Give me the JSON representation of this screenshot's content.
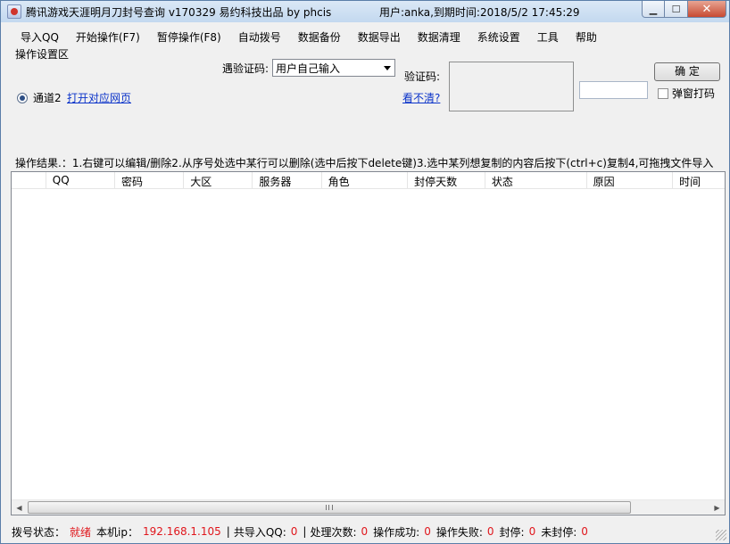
{
  "window": {
    "title": "腾讯游戏天涯明月刀封号查询  v170329  易约科技出品  by phcis",
    "user_info": "用户:anka,到期时间:2018/5/2 17:45:29",
    "minimize_glyph": "▁",
    "maximize_glyph": "☐",
    "close_glyph": "✕"
  },
  "menu": [
    {
      "label": "导入QQ"
    },
    {
      "label": "开始操作(F7)"
    },
    {
      "label": "暂停操作(F8)"
    },
    {
      "label": "自动拨号"
    },
    {
      "label": "数据备份"
    },
    {
      "label": "数据导出"
    },
    {
      "label": "数据清理"
    },
    {
      "label": "系统设置"
    },
    {
      "label": "工具"
    },
    {
      "label": "帮助"
    }
  ],
  "settings": {
    "group_title": "操作设置区",
    "channel_label": "通道2",
    "open_page_link": "打开对应网页",
    "vc_mode_label": "遇验证码:",
    "vc_mode_value": "用户自己输入",
    "vc_label": "验证码:",
    "unclear_link": "看不清?",
    "confirm_button": "确 定",
    "popup_checkbox": "弹窗打码",
    "captcha_value": ""
  },
  "result_line": "操作结果.：1.右键可以编辑/删除2.从序号处选中某行可以删除(选中后按下delete键)3.选中某列想复制的内容后按下(ctrl+c)复制4,可拖拽文件导入",
  "table": {
    "columns": [
      "",
      "QQ",
      "密码",
      "大区",
      "服务器",
      "角色",
      "封停天数",
      "状态",
      "原因",
      "时间"
    ],
    "rows": []
  },
  "status": {
    "dial_label": "拨号状态：",
    "dial_value": "就绪",
    "ip_label": "本机ip：",
    "ip_value": "192.168.1.105",
    "sep": "|",
    "imported_label": "共导入QQ:",
    "imported_value": "0",
    "processed_label": "处理次数:",
    "processed_value": "0",
    "success_label": "操作成功:",
    "success_value": "0",
    "fail_label": "操作失败:",
    "fail_value": "0",
    "banned_label": "封停:",
    "banned_value": "0",
    "unbanned_label": "未封停:",
    "unbanned_value": "0"
  },
  "colors": {
    "status_value": "#e0161c",
    "link": "#0b33c9"
  }
}
